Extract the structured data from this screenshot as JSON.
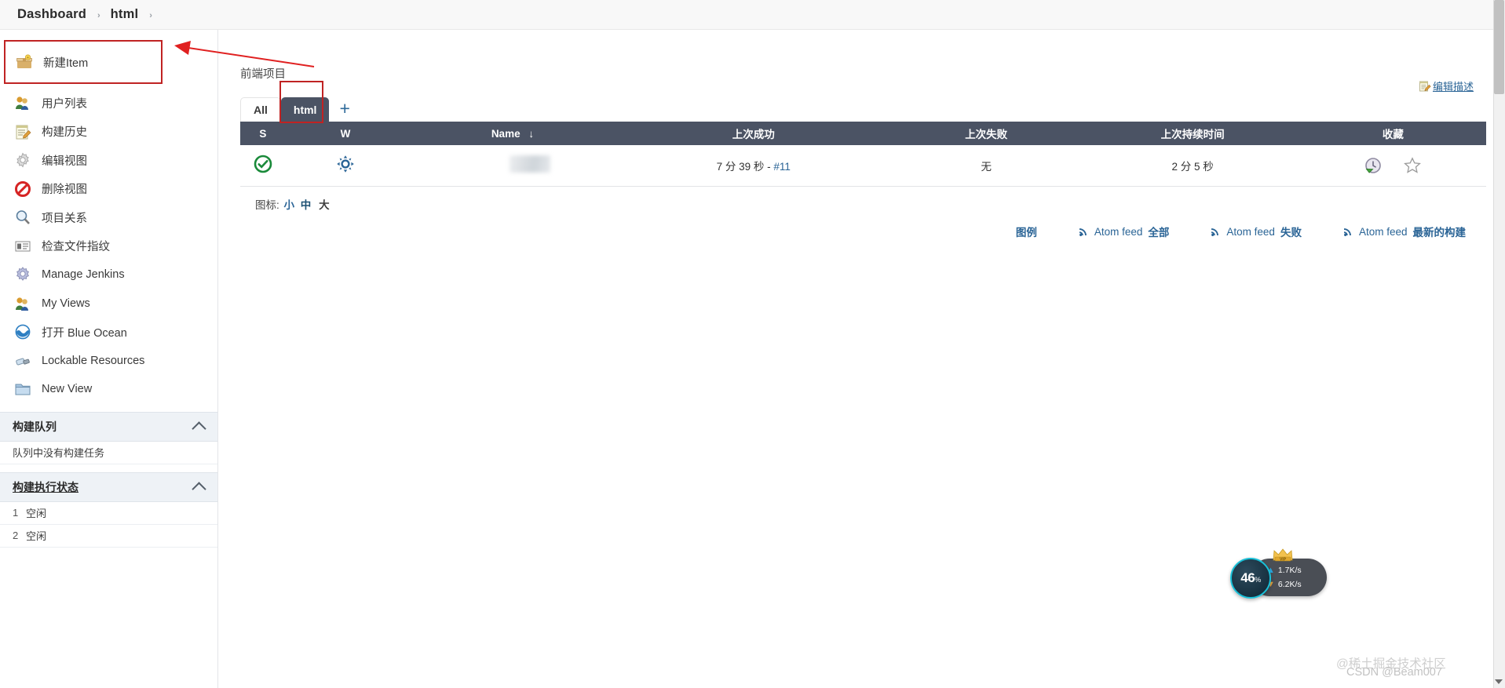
{
  "breadcrumb": {
    "items": [
      "Dashboard",
      "html"
    ],
    "separator": "›"
  },
  "sidebar": {
    "items": [
      {
        "label": "新建Item",
        "icon": "new-item-icon"
      },
      {
        "label": "用户列表",
        "icon": "people-icon"
      },
      {
        "label": "构建历史",
        "icon": "notepad-icon"
      },
      {
        "label": "编辑视图",
        "icon": "gear-icon"
      },
      {
        "label": "删除视图",
        "icon": "forbidden-icon"
      },
      {
        "label": "项目关系",
        "icon": "magnifier-icon"
      },
      {
        "label": "检查文件指纹",
        "icon": "fingerprint-card-icon"
      },
      {
        "label": "Manage Jenkins",
        "icon": "cog-icon"
      },
      {
        "label": "My Views",
        "icon": "people-icon"
      },
      {
        "label": "打开 Blue Ocean",
        "icon": "blue-ocean-icon"
      },
      {
        "label": "Lockable Resources",
        "icon": "usb-icon"
      },
      {
        "label": "New View",
        "icon": "folder-icon"
      }
    ],
    "build_queue": {
      "title": "构建队列",
      "empty_text": "队列中没有构建任务"
    },
    "executors": {
      "title": "构建执行状态",
      "rows": [
        {
          "num": "1",
          "status": "空闲"
        },
        {
          "num": "2",
          "status": "空闲"
        }
      ]
    }
  },
  "main": {
    "view_title": "前端项目",
    "edit_description": "编辑描述",
    "tabs": [
      {
        "label": "All",
        "active": false
      },
      {
        "label": "html",
        "active": true
      }
    ],
    "add_tab": "+",
    "table": {
      "headers": [
        "S",
        "W",
        "Name",
        "上次成功",
        "上次失败",
        "上次持续时间",
        "收藏"
      ],
      "sort_indicator": "↓",
      "rows": [
        {
          "status": "success",
          "weather": "sunny",
          "name": "",
          "last_success": "7 分 39 秒 - ",
          "last_success_build": "#11",
          "last_failure": "无",
          "last_duration": "2 分 5 秒",
          "schedule_icon": "schedule-build-icon",
          "favorite_icon": "star-icon"
        }
      ]
    },
    "icon_size": {
      "label": "图标:",
      "options": [
        "小",
        "中",
        "大"
      ],
      "selected": "中"
    },
    "footer_links": {
      "legend": "图例",
      "feeds": [
        {
          "prefix": "Atom feed ",
          "suffix": "全部"
        },
        {
          "prefix": "Atom feed ",
          "suffix": "失败"
        },
        {
          "prefix": "Atom feed ",
          "suffix": "最新的构建"
        }
      ]
    }
  },
  "network_widget": {
    "percent": "46",
    "percent_unit": "%",
    "upload": "1.7K/s",
    "download": "6.2K/s",
    "badge": "VIP"
  },
  "watermarks": {
    "top": "@稀土掘金技术社区",
    "bottom": "CSDN @Beam007"
  },
  "colors": {
    "header_dark": "#4b5364",
    "annotation_red": "#c02323",
    "link_blue": "#2a6496",
    "success_green": "#1a8a3a"
  }
}
